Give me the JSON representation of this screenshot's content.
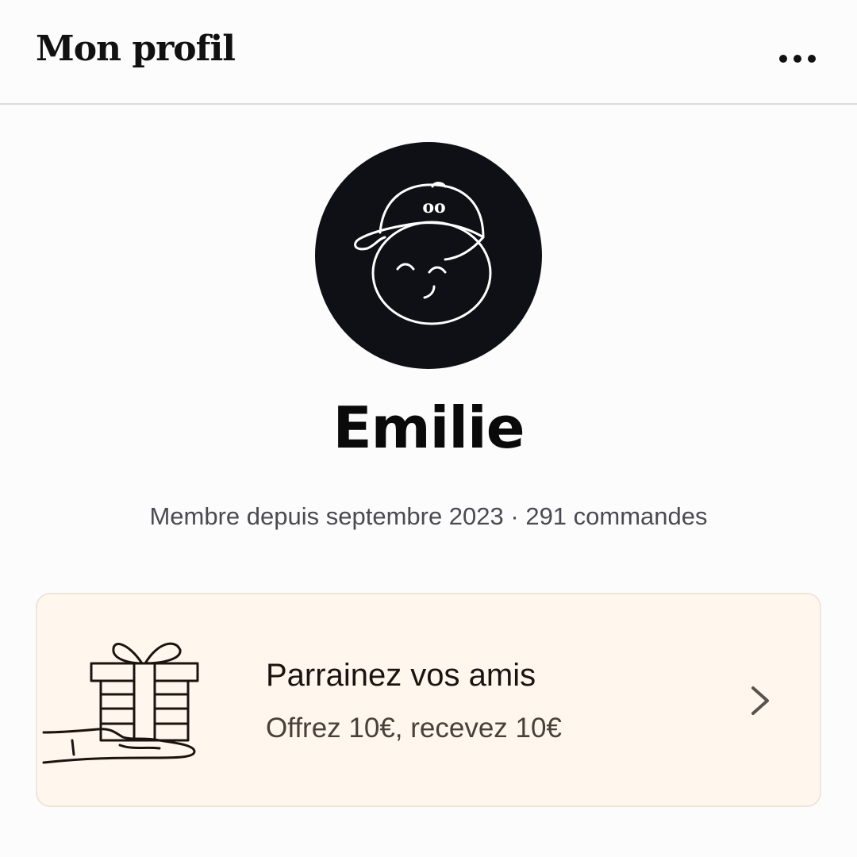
{
  "header": {
    "title": "Mon profil",
    "more_icon": "more-horizontal-icon"
  },
  "profile": {
    "name": "Emilie",
    "member_info": "Membre depuis septembre 2023 · 291 commandes",
    "avatar_icon": "cap-face-avatar",
    "cap_logo": "oo"
  },
  "referral": {
    "title": "Parrainez vos amis",
    "subtitle": "Offrez 10€, recevez 10€",
    "illustration_icon": "gift-in-hand-icon",
    "chevron_icon": "chevron-right-icon"
  },
  "colors": {
    "background": "#fdfcfd",
    "avatar_bg": "#0f1016",
    "card_bg": "#fff6ee",
    "card_border": "#efe5d9",
    "text_primary": "#111111",
    "text_secondary": "#4a4a50"
  }
}
